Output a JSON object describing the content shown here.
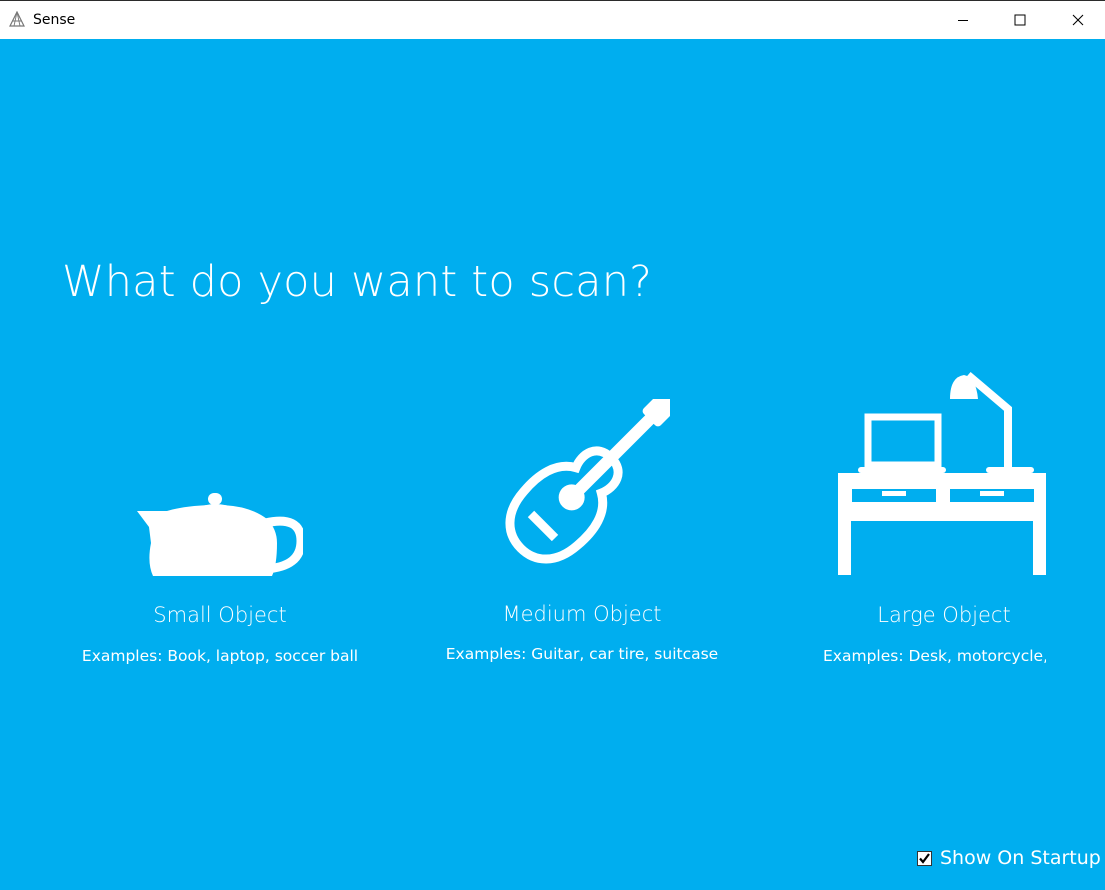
{
  "window": {
    "title": "Sense",
    "app_icon": "sense-logo-icon",
    "controls": [
      "minimize-icon",
      "maximize-icon",
      "close-icon"
    ]
  },
  "main": {
    "heading": "What do you want to scan?",
    "background_color": "#00aeef",
    "options": [
      {
        "icon": "teapot-icon",
        "label": "Small Object",
        "examples": "Examples: Book, laptop, soccer ball"
      },
      {
        "icon": "guitar-icon",
        "label": "Medium Object",
        "examples": "Examples: Guitar, car tire, suitcase"
      },
      {
        "icon": "desk-icon",
        "label": "Large Object",
        "examples": "Examples: Desk, motorcycle, sc"
      }
    ]
  },
  "footer": {
    "show_on_startup_label": "Show On Startup",
    "show_on_startup_checked": true
  }
}
